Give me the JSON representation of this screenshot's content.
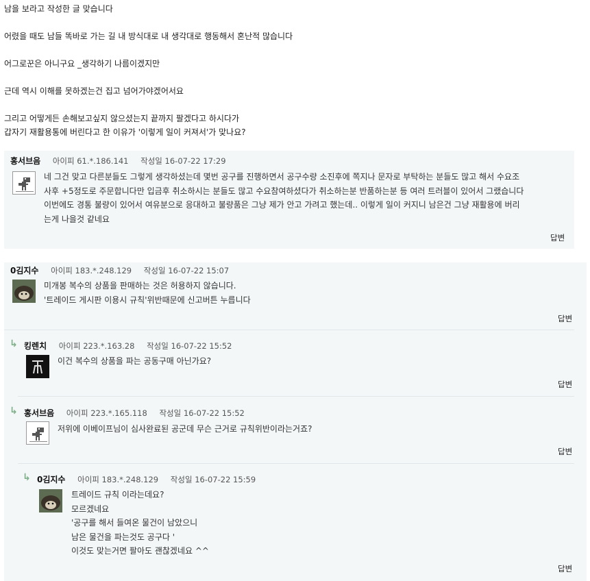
{
  "post": {
    "lines": [
      "남을 보라고 작성한 글 맞습니다",
      "어렸을 때도 남들 똑바로 가는 길 내 방식대로 내 생각대로 행동해서 혼난적 많습니다",
      "어그로꾼은 아니구요 _생각하기 나름이겠지만",
      "근데 역시 이해를 못하겠는건 집고 넘어가야겠어서요",
      "그리고 어떻게든 손해보고싶지 않으셨는지 끝까지 팔겠다고 하시다가",
      "갑자기 재활용통에 버린다고 한 이유가 '이렇게 일이 커져서'가 맞나요?"
    ]
  },
  "labels": {
    "ip": "아이피",
    "date": "작성일",
    "reply": "답변"
  },
  "comments": [
    {
      "name": "홍서브음",
      "ip": "61.*.186.141",
      "date": "16-07-22 17:29",
      "avatar": "dino-icon",
      "lines": [
        "네 그건 맞고 다른분들도 그렇게 생각하셨는데 몇번 공구를 진행하면서 공구수량 소진후에 쪽지나 문자로 부탁하는 분들도 많고 해서 수요조",
        "사후 +5정도로 주문합니다만 입금후 취소하시는 분들도 많고 수요참여하셨다가 취소하는분 반품하는분 등 여러 트러블이 있어서 그랬습니다",
        "이번에도 경통 불량이 있어서 여유분으로 응대하고 불량품은 그냥 제가 안고 가려고 했는데.. 이렇게 일이 커지니 남은건 그냥 재활용에 버리",
        "는게 나을것 같네요"
      ]
    },
    {
      "name": "0김지수",
      "ip": "183.*.248.129",
      "date": "16-07-22 15:07",
      "avatar": "hedgehog-avatar",
      "lines": [
        "미개봉 복수의 상품을 판매하는 것은 허용하지 않습니다.",
        "'트레이드 게시판 이용시 규칙'위반때문에 신고버튼 누릅니다"
      ]
    },
    {
      "name": "킹렌치",
      "ip": "223.*.163.28",
      "date": "16-07-22 15:52",
      "avatar": "tr-logo-avatar",
      "lines": [
        "이건 복수의 상품을 파는 공동구매 아닌가요?"
      ]
    },
    {
      "name": "홍서브음",
      "ip": "223.*.165.118",
      "date": "16-07-22 15:52",
      "avatar": "dino-icon",
      "lines": [
        "저위에 이베이프님이 심사완료된 공군데 무슨 근거로 규칙위반이라는거죠?"
      ]
    },
    {
      "name": "0김지수",
      "ip": "183.*.248.129",
      "date": "16-07-22 15:59",
      "avatar": "hedgehog-avatar",
      "lines": [
        "트레이드 규칙 이라는데요?",
        "모르겠네요",
        "'공구를 해서 들여온 물건이 남았으니",
        "남은 물건을 파는것도 공구다 '",
        "이것도 맞는거면 팔아도 괜찮겠네요 ^^"
      ]
    }
  ],
  "colors": {
    "comment_bg": "#f3f7f8",
    "reply_arrow": "#7fb08a",
    "divider": "#dfe7ea"
  }
}
